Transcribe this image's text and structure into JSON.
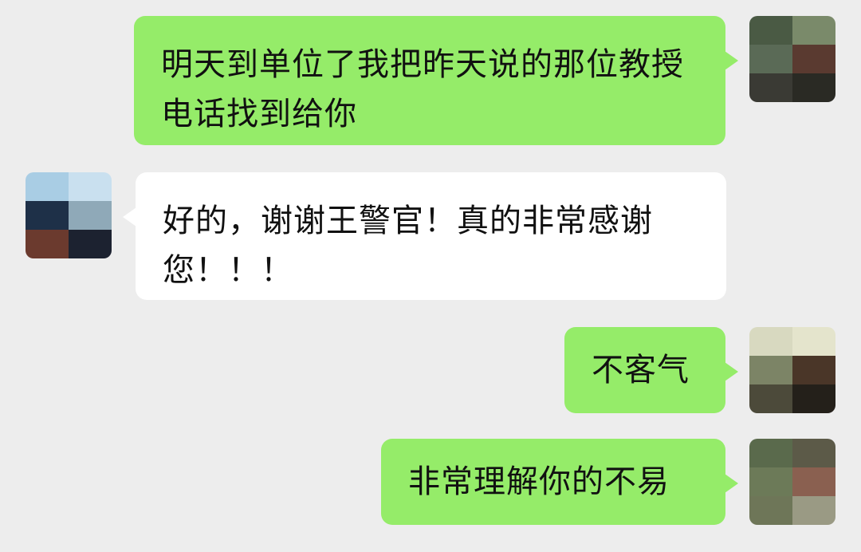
{
  "colors": {
    "background": "#ededed",
    "outgoing_bubble": "#95ec69",
    "incoming_bubble": "#ffffff",
    "text": "#111111"
  },
  "messages": [
    {
      "sender": "me",
      "text": "明天到单位了我把昨天说的那位教授电话找到给你"
    },
    {
      "sender": "other",
      "text": "好的，谢谢王警官！真的非常感谢您！！！"
    },
    {
      "sender": "me",
      "text": "不客气"
    },
    {
      "sender": "me",
      "text": "非常理解你的不易"
    }
  ],
  "avatars": {
    "me_icon": "pixelated-avatar-icon",
    "other_icon": "pixelated-avatar-icon"
  }
}
